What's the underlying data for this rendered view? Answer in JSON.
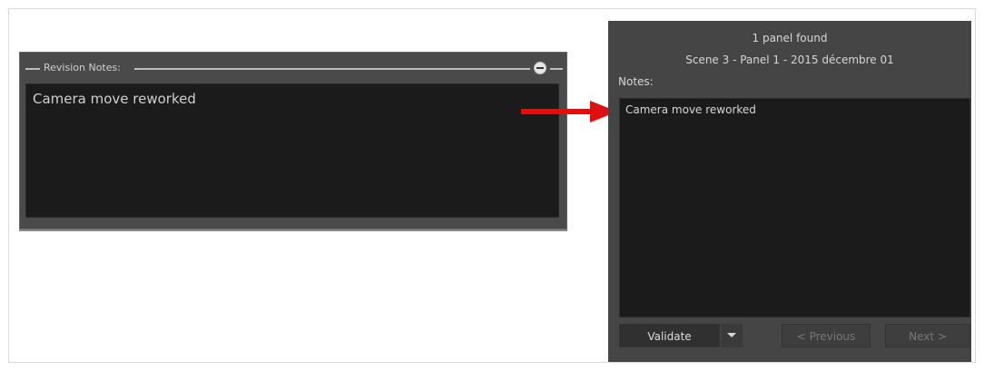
{
  "revision_panel": {
    "title": "Revision Notes:",
    "note_text": "Camera move reworked"
  },
  "search_panel": {
    "found_text": "1 panel found",
    "scene_text": "Scene 3 - Panel 1 - 2015 décembre 01",
    "notes_label": "Notes:",
    "notes_text": "Camera move reworked",
    "buttons": {
      "validate": "Validate",
      "previous": "< Previous",
      "next": "Next >"
    }
  },
  "colors": {
    "arrow": "#e01010",
    "panel_bg": "#454545",
    "text_area_bg": "#1b1b1b"
  },
  "icons": {
    "minimize": "minus-circle-icon",
    "dropdown": "chevron-down-icon",
    "arrow": "right-arrow"
  }
}
